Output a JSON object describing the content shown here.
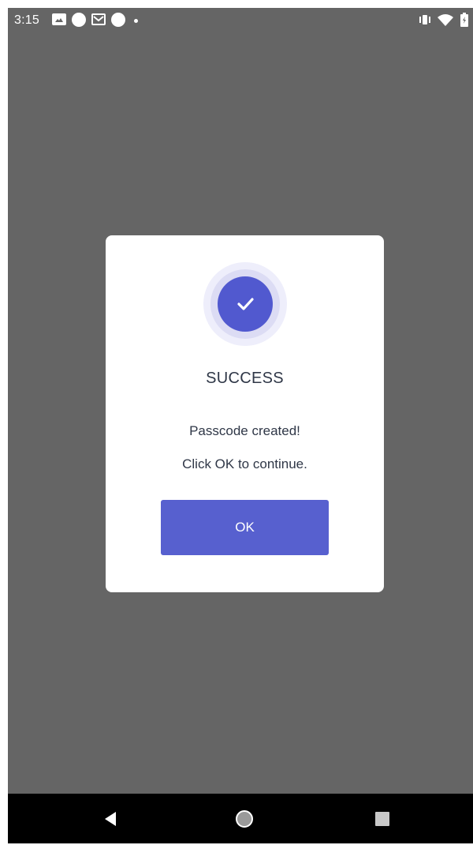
{
  "status_bar": {
    "time": "3:15",
    "icons": [
      "photo-icon",
      "circle-notification-icon",
      "mail-icon",
      "circle-notification-icon",
      "dot-icon",
      "vibrate-icon",
      "wifi-icon",
      "battery-icon"
    ]
  },
  "dialog": {
    "icon": "check-circle-icon",
    "title": "SUCCESS",
    "message_line1": "Passcode created!",
    "message_line2": "Click OK to continue.",
    "ok_label": "OK"
  },
  "nav_bar": {
    "icons": [
      "back-icon",
      "home-icon",
      "recents-icon"
    ]
  },
  "colors": {
    "scrim": "#656565",
    "accent": "#5760cf",
    "text": "#2f3747"
  }
}
